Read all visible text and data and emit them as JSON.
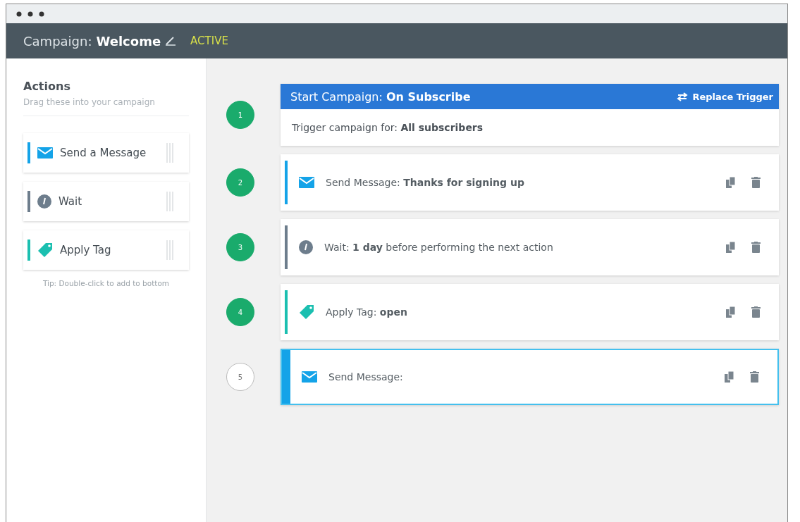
{
  "header": {
    "label": "Campaign:",
    "name": "Welcome",
    "status": "ACTIVE"
  },
  "sidebar": {
    "title": "Actions",
    "subtitle": "Drag these into your campaign",
    "actions": [
      {
        "kind": "message",
        "label": "Send a Message"
      },
      {
        "kind": "wait",
        "label": "Wait"
      },
      {
        "kind": "tag",
        "label": "Apply Tag"
      }
    ],
    "tip": "Tip: Double-click to add to bottom"
  },
  "trigger": {
    "number": "1",
    "complete": true,
    "title": "Start Campaign: **On Subscribe**",
    "button": "Replace Trigger",
    "body": "Trigger campaign for: **All subscribers**"
  },
  "steps": [
    {
      "number": "2",
      "complete": true,
      "kind": "message",
      "text": "Send Message: **Thanks for signing up**",
      "selected": false
    },
    {
      "number": "3",
      "complete": true,
      "kind": "wait",
      "text": "Wait: **1 day** before performing the next action",
      "selected": false
    },
    {
      "number": "4",
      "complete": true,
      "kind": "tag",
      "text": "Apply Tag: **open**",
      "selected": false
    },
    {
      "number": "5",
      "complete": false,
      "kind": "message",
      "text": "Send Message:",
      "selected": true
    }
  ]
}
